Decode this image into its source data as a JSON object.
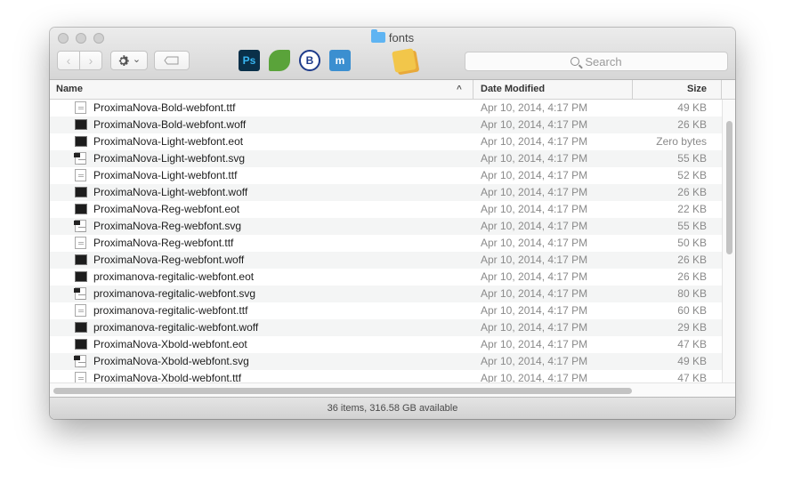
{
  "window": {
    "title": "fonts",
    "folder_icon": "folder-icon"
  },
  "toolbar": {
    "back_glyph": "‹",
    "forward_glyph": "›",
    "action_icon": "gear-icon",
    "action_chevron": "⌄",
    "tag_icon": "tag-icon",
    "apps": [
      {
        "name": "photoshop-app-icon",
        "label": "Ps",
        "bg": "#0a3049",
        "fg": "#38b6f2"
      },
      {
        "name": "leaf-app-icon",
        "label": "",
        "bg": "#5aa33a",
        "fg": "#ffffff"
      },
      {
        "name": "bbedit-app-icon",
        "label": "B",
        "bg": "#ffffff",
        "fg": "#1d3a8a"
      },
      {
        "name": "writer-app-icon",
        "label": "m",
        "bg": "#3b8fd0",
        "fg": "#ffffff"
      },
      {
        "name": "stickies-app-icon",
        "label": "",
        "bg": "#f2c64a",
        "fg": "#ffffff"
      }
    ]
  },
  "search": {
    "placeholder": "Search"
  },
  "columns": {
    "name": "Name",
    "sort_glyph": "^",
    "date": "Date Modified",
    "size": "Size"
  },
  "files": [
    {
      "icon": "doc",
      "name": "ProximaNova-Bold-webfont.ttf",
      "date": "Apr 10, 2014, 4:17 PM",
      "size": "49 KB"
    },
    {
      "icon": "dark",
      "name": "ProximaNova-Bold-webfont.woff",
      "date": "Apr 10, 2014, 4:17 PM",
      "size": "26 KB"
    },
    {
      "icon": "dark",
      "name": "ProximaNova-Light-webfont.eot",
      "date": "Apr 10, 2014, 4:17 PM",
      "size": "Zero bytes"
    },
    {
      "icon": "svg",
      "name": "ProximaNova-Light-webfont.svg",
      "date": "Apr 10, 2014, 4:17 PM",
      "size": "55 KB"
    },
    {
      "icon": "doc",
      "name": "ProximaNova-Light-webfont.ttf",
      "date": "Apr 10, 2014, 4:17 PM",
      "size": "52 KB"
    },
    {
      "icon": "dark",
      "name": "ProximaNova-Light-webfont.woff",
      "date": "Apr 10, 2014, 4:17 PM",
      "size": "26 KB"
    },
    {
      "icon": "dark",
      "name": "ProximaNova-Reg-webfont.eot",
      "date": "Apr 10, 2014, 4:17 PM",
      "size": "22 KB"
    },
    {
      "icon": "svg",
      "name": "ProximaNova-Reg-webfont.svg",
      "date": "Apr 10, 2014, 4:17 PM",
      "size": "55 KB"
    },
    {
      "icon": "doc",
      "name": "ProximaNova-Reg-webfont.ttf",
      "date": "Apr 10, 2014, 4:17 PM",
      "size": "50 KB"
    },
    {
      "icon": "dark",
      "name": "ProximaNova-Reg-webfont.woff",
      "date": "Apr 10, 2014, 4:17 PM",
      "size": "26 KB"
    },
    {
      "icon": "dark",
      "name": "proximanova-regitalic-webfont.eot",
      "date": "Apr 10, 2014, 4:17 PM",
      "size": "26 KB"
    },
    {
      "icon": "svg",
      "name": "proximanova-regitalic-webfont.svg",
      "date": "Apr 10, 2014, 4:17 PM",
      "size": "80 KB"
    },
    {
      "icon": "doc",
      "name": "proximanova-regitalic-webfont.ttf",
      "date": "Apr 10, 2014, 4:17 PM",
      "size": "60 KB"
    },
    {
      "icon": "dark",
      "name": "proximanova-regitalic-webfont.woff",
      "date": "Apr 10, 2014, 4:17 PM",
      "size": "29 KB"
    },
    {
      "icon": "dark",
      "name": "ProximaNova-Xbold-webfont.eot",
      "date": "Apr 10, 2014, 4:17 PM",
      "size": "47 KB"
    },
    {
      "icon": "svg",
      "name": "ProximaNova-Xbold-webfont.svg",
      "date": "Apr 10, 2014, 4:17 PM",
      "size": "49 KB"
    },
    {
      "icon": "doc",
      "name": "ProximaNova-Xbold-webfont.ttf",
      "date": "Apr 10, 2014, 4:17 PM",
      "size": "47 KB"
    }
  ],
  "status": {
    "text": "36 items, 316.58 GB available"
  }
}
